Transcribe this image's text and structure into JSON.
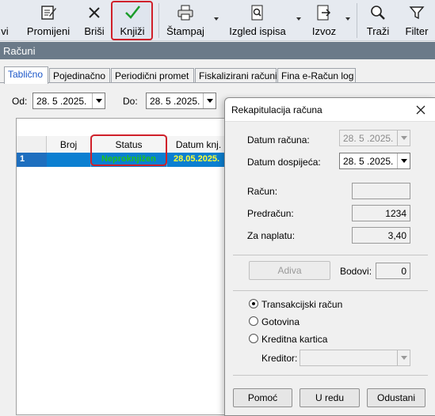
{
  "toolbar": {
    "cut_label": "vi",
    "buttons": [
      {
        "label": "Promijeni",
        "icon": "edit-icon"
      },
      {
        "label": "Briši",
        "icon": "delete-icon"
      },
      {
        "label": "Knjiži",
        "icon": "checkmark-icon"
      },
      {
        "label": "Štampaj",
        "icon": "printer-icon"
      },
      {
        "label": "Izgled ispisa",
        "icon": "print-preview-icon"
      },
      {
        "label": "Izvoz",
        "icon": "export-icon"
      },
      {
        "label": "Traži",
        "icon": "search-icon"
      },
      {
        "label": "Filter",
        "icon": "filter-icon"
      }
    ]
  },
  "window": {
    "title": "Računi"
  },
  "tabs": [
    "Tablično",
    "Pojedinačno",
    "Periodični promet",
    "Fiskalizirani računi",
    "Fina e-Račun log"
  ],
  "filters": {
    "od_label": "Od:",
    "od_value": "28. 5 .2025.",
    "do_label": "Do:",
    "do_value": "28. 5 .2025."
  },
  "grid": {
    "columns": [
      "Broj",
      "Status",
      "Datum knj."
    ],
    "rows": [
      {
        "index": "1",
        "broj": "",
        "status": "Neproknjižen",
        "datum": "28.05.2025."
      }
    ]
  },
  "dialog": {
    "title": "Rekapitulacija računa",
    "datum_racuna_label": "Datum računa:",
    "datum_racuna_value": "28. 5 .2025.",
    "datum_dospijeca_label": "Datum dospijeća:",
    "datum_dospijeca_value": "28. 5 .2025.",
    "racun_label": "Račun:",
    "racun_value": "",
    "predracun_label": "Predračun:",
    "predracun_value": "1234",
    "za_naplatu_label": "Za naplatu:",
    "za_naplatu_value": "3,40",
    "adiva_label": "Adiva",
    "bodovi_label": "Bodovi:",
    "bodovi_value": "0",
    "payment_options": [
      "Transakcijski račun",
      "Gotovina",
      "Kreditna kartica"
    ],
    "selected_payment": "Transakcijski račun",
    "kreditor_label": "Kreditor:",
    "kreditor_value": "",
    "pomoc_label": "Pomoć",
    "u_redu_label": "U redu",
    "odustani_label": "Odustani"
  },
  "colors": {
    "selected_row": "#0b7fd1",
    "status_text": "#1fc21f",
    "date_text": "#ffff33",
    "highlight_border": "#d0202a",
    "active_tab_text": "#1a56c8"
  }
}
